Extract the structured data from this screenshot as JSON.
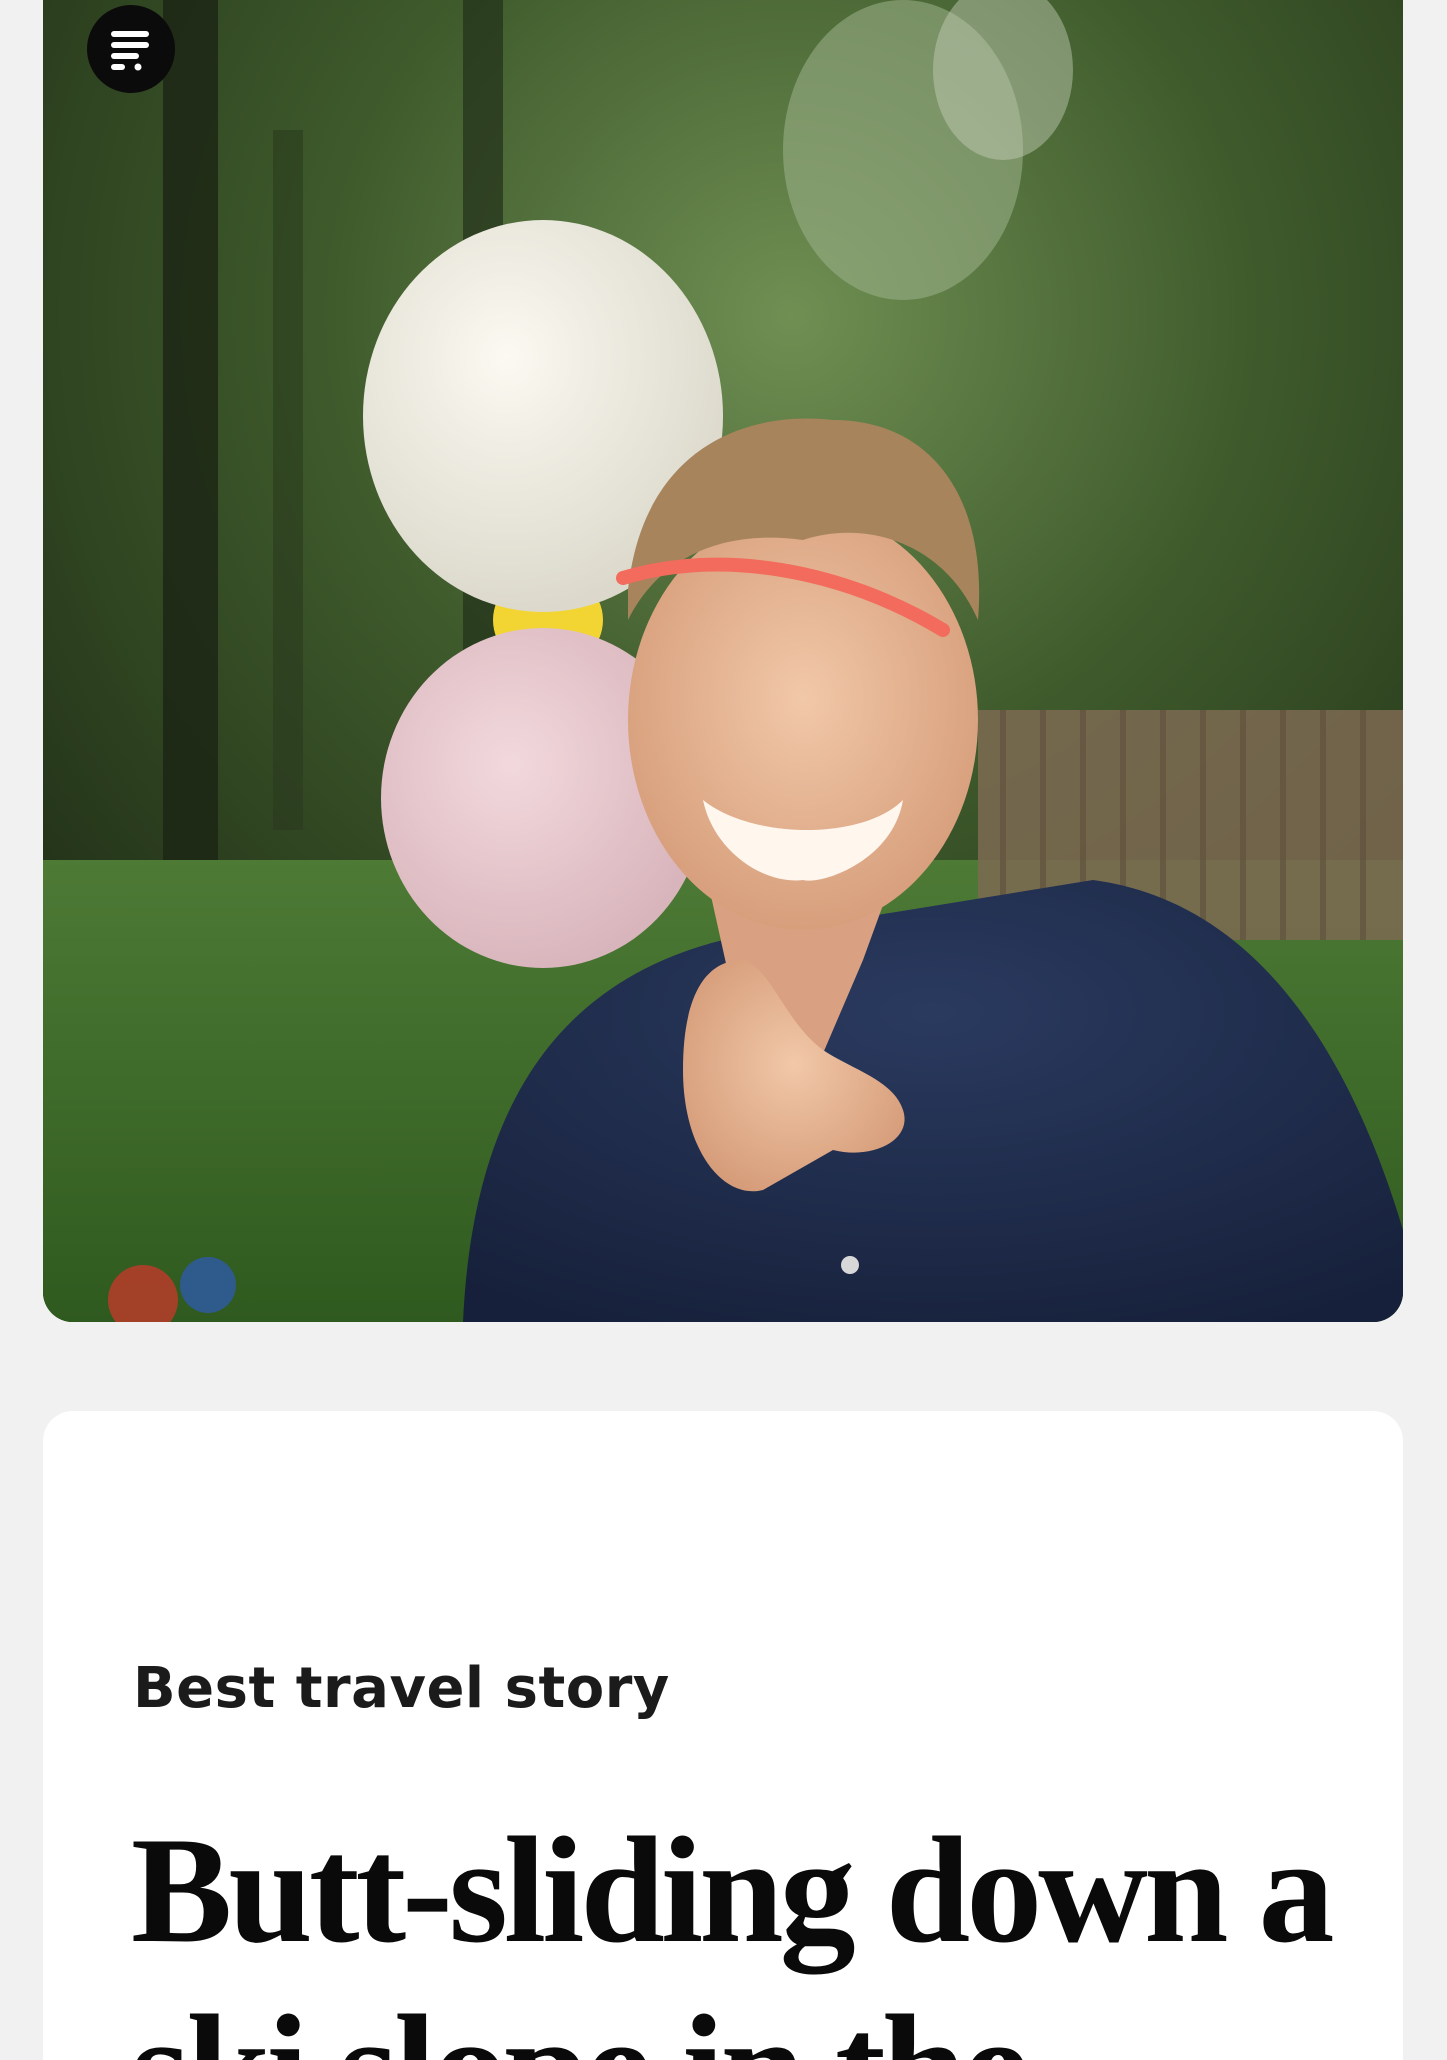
{
  "header": {
    "menu_icon": "menu-lines-icon"
  },
  "hero": {
    "image_description": "hero-photo"
  },
  "article": {
    "category": "Best travel story",
    "headline": "Butt-sliding down a ski slope in the"
  },
  "colors": {
    "page_background": "#f1f1f1",
    "card_background": "#ffffff",
    "text": "#0a0a0a",
    "menu_button": "#0b0b0b"
  }
}
